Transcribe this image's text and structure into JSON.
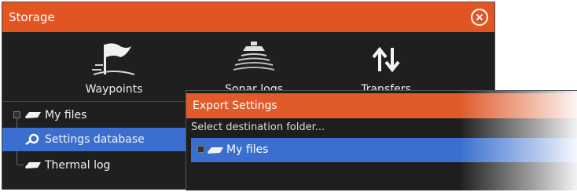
{
  "storage": {
    "title": "Storage",
    "tools": [
      {
        "label": "Waypoints",
        "icon": "flag-icon"
      },
      {
        "label": "Sonar logs",
        "icon": "sonar-icon"
      },
      {
        "label": "Transfers",
        "icon": "transfer-arrows-icon"
      }
    ],
    "tree": [
      {
        "label": "My files",
        "icon": "disk-icon"
      },
      {
        "label": "Settings database",
        "icon": "settings-gear-icon",
        "selected": true
      },
      {
        "label": "Thermal log",
        "icon": "disk-icon"
      }
    ]
  },
  "export": {
    "title": "Export Settings",
    "prompt": "Select destination folder...",
    "destination": {
      "label": "My files",
      "icon": "disk-icon",
      "selected": true
    }
  },
  "colors": {
    "titlebar": "#e35423",
    "selection": "#3a6fd0",
    "background": "#1f1f1f"
  }
}
